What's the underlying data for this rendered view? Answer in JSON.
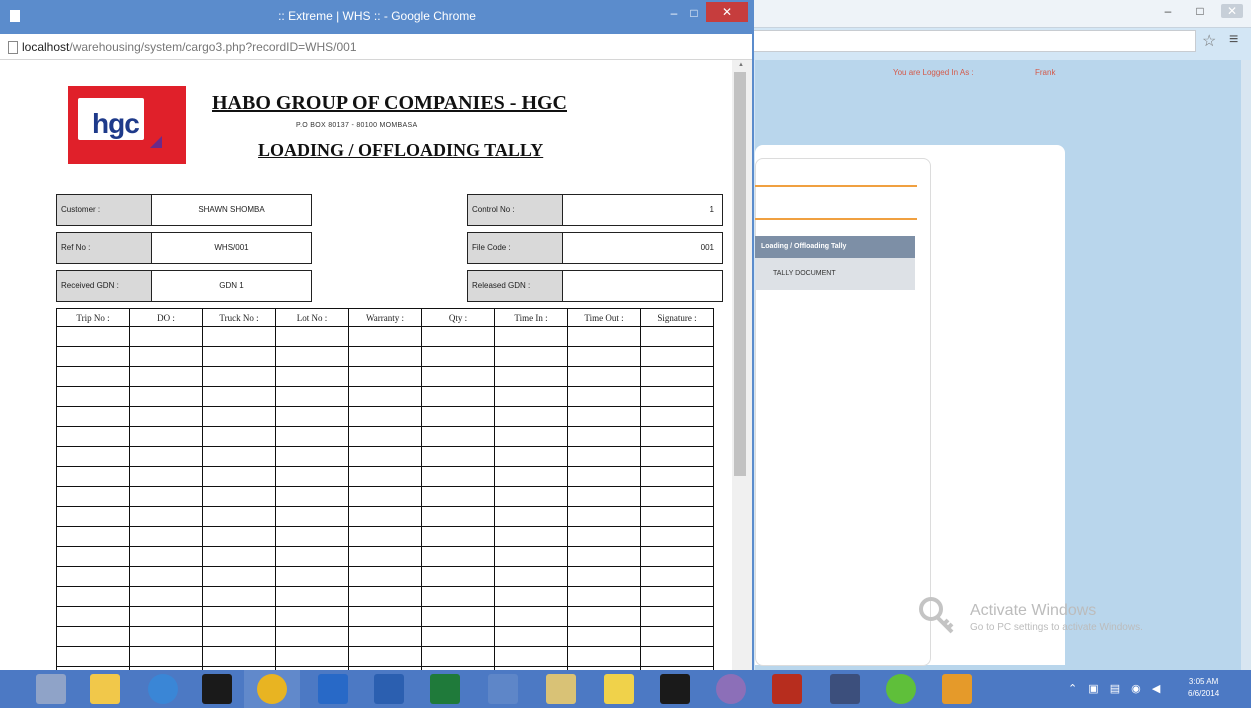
{
  "popup": {
    "window_title": ":: Extreme | WHS :: - Google Chrome",
    "url_host": "localhost",
    "url_path": "/warehousing/system/cargo3.php?recordID=WHS/001",
    "controls": {
      "minimize": "–",
      "maximize": "□",
      "close": "✕"
    }
  },
  "doc": {
    "logo_text": "hgc",
    "company": "HABO GROUP OF COMPANIES - HGC",
    "address": "P.O BOX 80137 - 80100 MOMBASA",
    "title": "LOADING / OFFLOADING TALLY"
  },
  "fields": {
    "customer_label": "Customer :",
    "customer_value": "SHAWN SHOMBA",
    "ref_label": "Ref No :",
    "ref_value": "WHS/001",
    "received_label": "Received GDN :",
    "received_value": "GDN 1",
    "control_label": "Control No :",
    "control_value": "1",
    "filecode_label": "File Code :",
    "filecode_value": "001",
    "released_label": "Released GDN :",
    "released_value": ""
  },
  "tally": {
    "headers": [
      "Trip No :",
      "DO :",
      "Truck No :",
      "Lot No :",
      "Warranty :",
      "Qty :",
      "Time In :",
      "Time Out :",
      "Signature :"
    ]
  },
  "background": {
    "logged_in_label": "You are Logged In As :",
    "user": "Frank",
    "menu_header": "Loading / Offloading Tally",
    "menu_item": "TALLY DOCUMENT",
    "activate_title": "Activate Windows",
    "activate_sub": "Go to PC settings to activate Windows."
  },
  "taskbar": {
    "time": "3:05 AM",
    "date": "6/6/2014"
  },
  "colors": {
    "chrome_blue": "#5b8ccc",
    "close_red": "#c63d3d",
    "taskbar": "#4c79c4",
    "menu_header": "#7d8fa6",
    "accent_orange": "#f0a040"
  }
}
